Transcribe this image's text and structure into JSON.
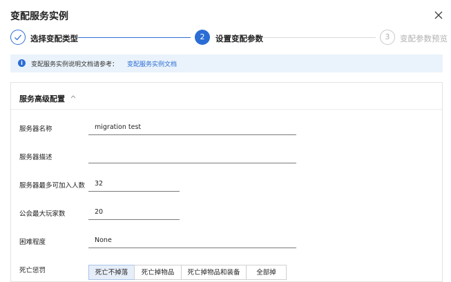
{
  "dialog": {
    "title": "变配服务实例"
  },
  "steps": [
    {
      "label": "选择变配类型",
      "state": "done"
    },
    {
      "number": "2",
      "label": "设置变配参数",
      "state": "active"
    },
    {
      "number": "3",
      "label": "变配参数预览",
      "state": "pending"
    }
  ],
  "notice": {
    "text": "变配服务实例说明文档请参考：",
    "link": "变配服务实例文档"
  },
  "panel": {
    "title": "服务高级配置",
    "fields": {
      "server_name": {
        "label": "服务器名称",
        "value": "migration test"
      },
      "server_desc": {
        "label": "服务器描述",
        "value": ""
      },
      "max_players": {
        "label": "服务器最多可加入人数",
        "value": "32"
      },
      "guild_max": {
        "label": "公会最大玩家数",
        "value": "20"
      },
      "difficulty": {
        "label": "困难程度",
        "value": "None"
      },
      "death_penalty": {
        "label": "死亡惩罚",
        "options": [
          "死亡不掉落",
          "死亡掉物品",
          "死亡掉物品和装备",
          "全部掉"
        ],
        "selected": "死亡不掉落"
      }
    }
  },
  "colors": {
    "accent": "#2b6dd5",
    "notice_bg": "#eaf3fb",
    "pending": "#b0b0b0"
  }
}
